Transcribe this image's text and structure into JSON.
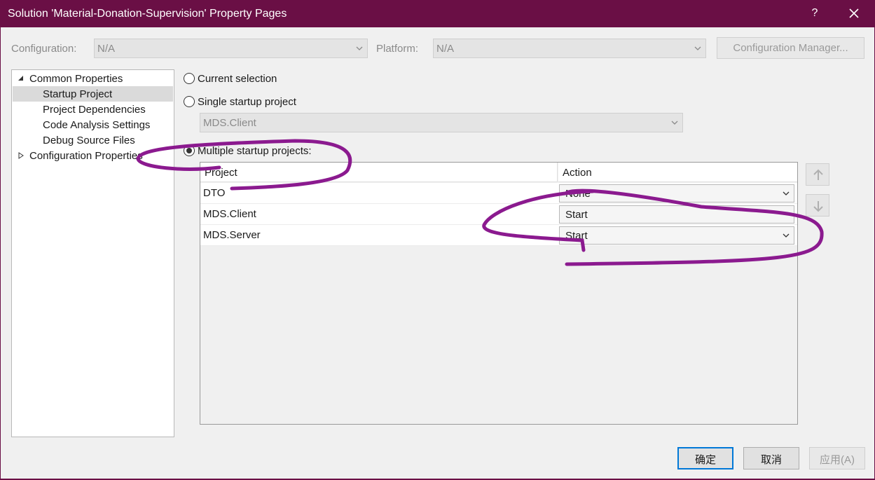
{
  "window": {
    "title": "Solution 'Material-Donation-Supervision' Property Pages",
    "help": "?",
    "close_icon": "close-icon"
  },
  "toolbar": {
    "configuration_label": "Configuration:",
    "configuration_value": "N/A",
    "platform_label": "Platform:",
    "platform_value": "N/A",
    "config_manager_label": "Configuration Manager..."
  },
  "tree": {
    "common": "Common Properties",
    "startup": "Startup Project",
    "dependencies": "Project Dependencies",
    "code_analysis": "Code Analysis Settings",
    "debug_source": "Debug Source Files",
    "configuration": "Configuration Properties"
  },
  "options": {
    "current_selection": "Current selection",
    "single_startup": "Single startup project",
    "single_value": "MDS.Client",
    "multiple_startup": "Multiple startup projects:",
    "selected": "multiple"
  },
  "grid": {
    "col_project": "Project",
    "col_action": "Action",
    "rows": [
      {
        "project": "DTO",
        "action": "None"
      },
      {
        "project": "MDS.Client",
        "action": "Start"
      },
      {
        "project": "MDS.Server",
        "action": "Start"
      }
    ]
  },
  "footer": {
    "ok": "确定",
    "cancel": "取消",
    "apply": "应用(A)"
  },
  "colors": {
    "titlebar": "#6a0f45",
    "annotation": "#8b1a8f"
  }
}
